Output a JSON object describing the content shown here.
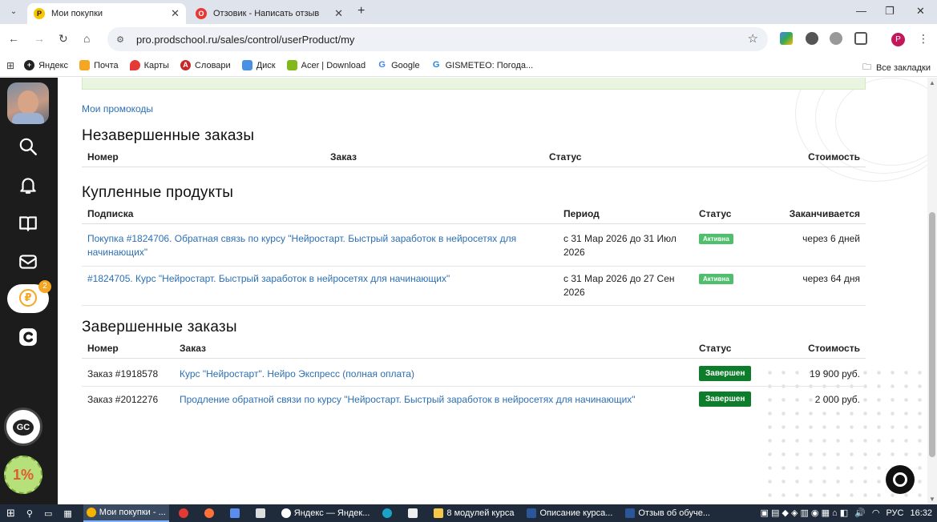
{
  "browser": {
    "tabs": [
      {
        "title": "Мои покупки",
        "active": true
      },
      {
        "title": "Отзовик - Написать отзыв",
        "active": false
      }
    ],
    "url": "pro.prodschool.ru/sales/control/userProduct/my",
    "profile_initial": "P",
    "bookmarks": [
      "Яндекс",
      "Почта",
      "Карты",
      "Словари",
      "Диск",
      "Acer | Download",
      "Google",
      "GISMETEO: Погода..."
    ],
    "all_bookmarks": "Все закладки"
  },
  "sidebar": {
    "badge_count": "2",
    "gc_logo_text": "GC",
    "one_percent_text": "1%"
  },
  "page": {
    "promo_link": "Мои промокоды",
    "unfinished": {
      "title": "Незавершенные заказы",
      "headers": [
        "Номер",
        "Заказ",
        "Статус",
        "Стоимость"
      ]
    },
    "purchased": {
      "title": "Купленные продукты",
      "headers": [
        "Подписка",
        "Период",
        "Статус",
        "Заканчивается"
      ],
      "rows": [
        {
          "name": "Покупка #1824706. Обратная связь по курсу \"Нейростарт. Быстрый заработок в нейросетях для начинающих\"",
          "period": "с 31 Мар 2026 до 31 Июл 2026",
          "status": "Активна",
          "ends": "через 6 дней"
        },
        {
          "name": "#1824705. Курс \"Нейростарт. Быстрый заработок в нейросетях для начинающих\"",
          "period": "с 31 Мар 2026 до 27 Сен 2026",
          "status": "Активна",
          "ends": "через 64 дня"
        }
      ]
    },
    "finished": {
      "title": "Завершенные заказы",
      "headers": [
        "Номер",
        "Заказ",
        "Статус",
        "Стоимость"
      ],
      "rows": [
        {
          "number": "Заказ #1918578",
          "order": "Курс \"Нейростарт\". Нейро Экспресс (полная оплата)",
          "status": "Завершен",
          "cost": "19 900 руб."
        },
        {
          "number": "Заказ #2012276",
          "order": "Продление обратной связи по курсу \"Нейростарт. Быстрый заработок в нейросетях для начинающих\"",
          "status": "Завершен",
          "cost": "2 000 руб."
        }
      ]
    }
  },
  "taskbar": {
    "items": [
      "Мои покупки - ...",
      "Яндекс — Яндек...",
      "8 модулей курса",
      "Описание курса...",
      "Отзыв об обуче..."
    ],
    "lang": "РУС",
    "time": "16:32"
  },
  "colors": {
    "link": "#2c6fb3",
    "active_pill": "#4fbe6d",
    "done_pill": "#0d7d2c",
    "sidebar": "#1c1c1c"
  }
}
